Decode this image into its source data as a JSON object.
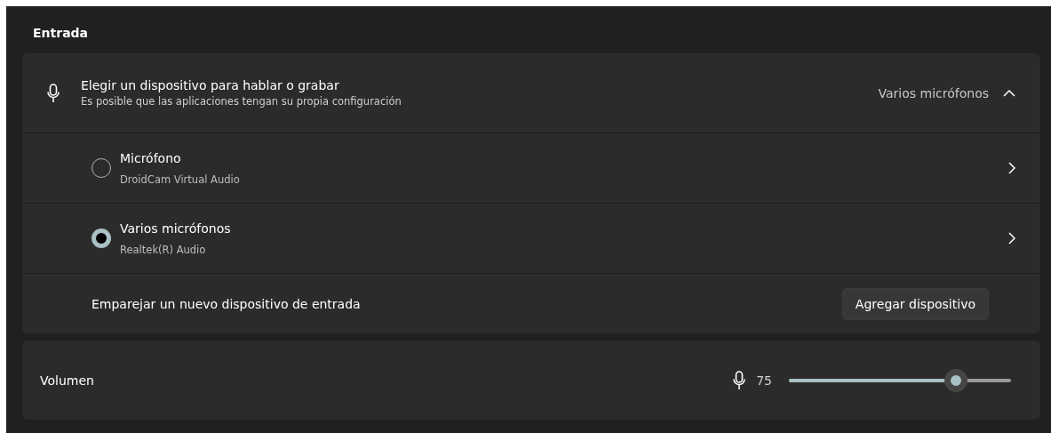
{
  "section_title": "Entrada",
  "device_picker": {
    "title": "Elegir un dispositivo para hablar o grabar",
    "subtitle": "Es posible que las aplicaciones tengan su propia configuración",
    "current": "Varios micrófonos",
    "expanded": true,
    "devices": [
      {
        "name": "Micrófono",
        "driver": "DroidCam Virtual Audio",
        "selected": false
      },
      {
        "name": "Varios micrófonos",
        "driver": "Realtek(R) Audio",
        "selected": true
      }
    ],
    "pair": {
      "label": "Emparejar un nuevo dispositivo de entrada",
      "button": "Agregar dispositivo"
    }
  },
  "volume": {
    "label": "Volumen",
    "reading": "75",
    "level": 0.75
  }
}
